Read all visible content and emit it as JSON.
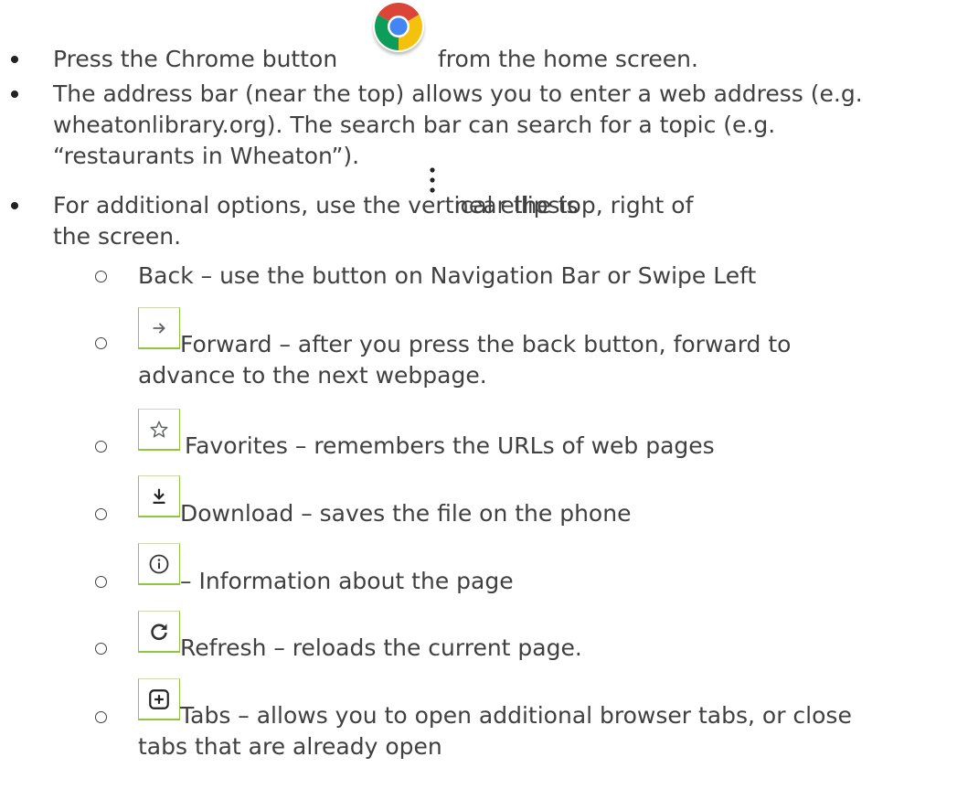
{
  "bullets": [
    {
      "lines": [
        "Press the Chrome button",
        "from the home screen."
      ],
      "icon": "chrome-icon"
    },
    {
      "lines": [
        "The address bar (near the top) allows you to enter a web address (e.g.",
        "wheatonlibrary.org). The search bar can search for a topic (e.g.",
        "“restaurants in Wheaton”)."
      ]
    },
    {
      "lines": [
        "For additional options, use the vertical ellipsis",
        "near the top, right of",
        "the screen."
      ],
      "icon": "vertical-ellipsis-icon"
    }
  ],
  "options": [
    {
      "lines": [
        "Back – use the button on Navigation Bar or Swipe Left"
      ]
    },
    {
      "icon": "forward-arrow-icon",
      "lines": [
        "Forward – after you press the back button, forward to",
        "advance to the next webpage."
      ]
    },
    {
      "icon": "star-icon",
      "lines": [
        "Favorites – remembers the URLs of web pages"
      ]
    },
    {
      "icon": "download-icon",
      "lines": [
        "Download – saves the file on the phone"
      ]
    },
    {
      "icon": "info-icon",
      "lines": [
        "– Information about the page"
      ]
    },
    {
      "icon": "refresh-icon",
      "lines": [
        "Refresh – reloads the current page."
      ]
    },
    {
      "icon": "new-tab-icon",
      "lines": [
        "Tabs – allows you to open additional browser tabs, or close",
        "tabs that are already open"
      ]
    }
  ],
  "colors": {
    "text": "#404040",
    "icon_box_border": "#8ec63f",
    "icon_glyph": "#5f6368"
  }
}
